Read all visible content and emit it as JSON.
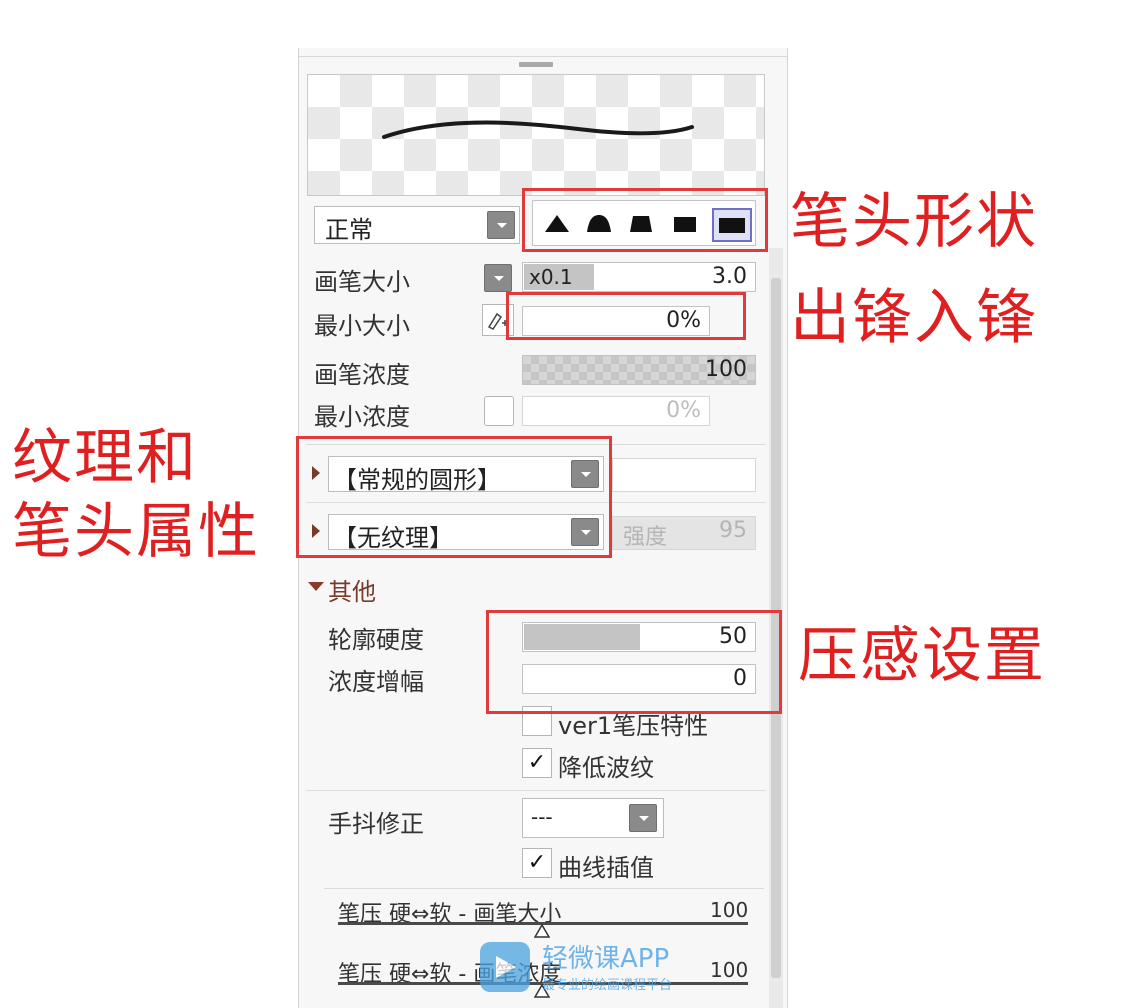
{
  "blend_mode": {
    "value": "正常"
  },
  "tip_shapes": {
    "options": [
      "sharp-tip",
      "round-tip",
      "flat-tip",
      "square-tip",
      "box-tip"
    ],
    "selected_index": 4
  },
  "brush_size": {
    "label": "画笔大小",
    "multiplier": "x0.1",
    "value": "3.0"
  },
  "min_size": {
    "label": "最小大小",
    "value": "0%"
  },
  "brush_density": {
    "label": "画笔浓度",
    "value": "100"
  },
  "min_density": {
    "label": "最小浓度",
    "value": "0%"
  },
  "brush_shape": {
    "value": "【常规的圆形】"
  },
  "texture": {
    "value": "【无纹理】",
    "strength_label": "强度",
    "strength_value": "95"
  },
  "other": {
    "section_label": "其他",
    "edge_hardness": {
      "label": "轮廓硬度",
      "value": "50",
      "fraction": 0.5
    },
    "density_gain": {
      "label": "浓度增幅",
      "value": "0"
    },
    "ver1_pressure": {
      "label": "ver1笔压特性",
      "checked": false
    },
    "reduce_ripple": {
      "label": "降低波纹",
      "checked": true
    }
  },
  "stabilizer": {
    "label": "手抖修正",
    "value": "---"
  },
  "curve_interp": {
    "label": "曲线插值",
    "checked": true
  },
  "pressure_size": {
    "label": "笔压 硬⇔软 - 画笔大小",
    "value": "100"
  },
  "pressure_density": {
    "label": "笔压 硬⇔软 - 画笔浓度",
    "value": "100"
  },
  "annotations": {
    "tip_shape": "笔头形状",
    "taper": "出锋入锋",
    "texture_line1": "纹理和",
    "texture_line2": "笔头属性",
    "pressure": "压感设置"
  },
  "watermark": {
    "title": "轻微课APP",
    "subtitle": "最专业的绘画课程平台"
  },
  "colors": {
    "annotation_red": "#e02020",
    "panel_bg": "#f7f7f7"
  }
}
